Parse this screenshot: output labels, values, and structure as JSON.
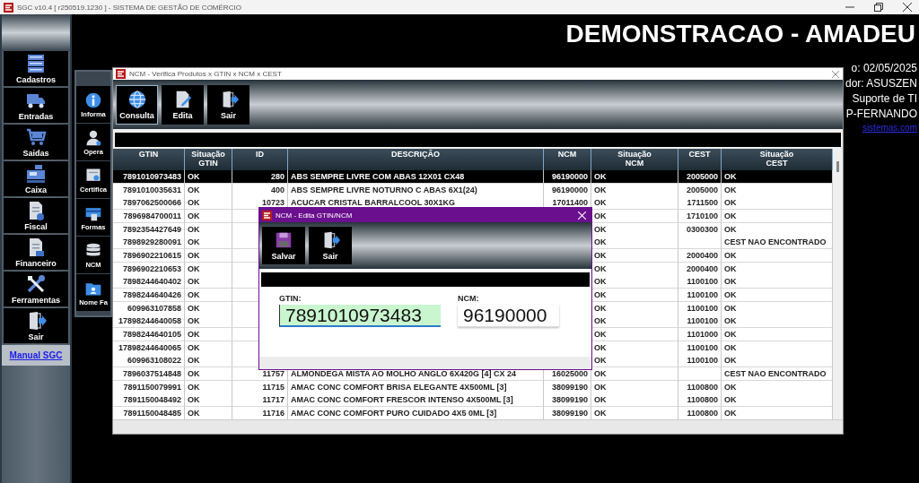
{
  "window": {
    "title": "SGC v10.4 [ r250519.1230 ] - SISTEMA DE GESTÃO DE COMÉRCIO"
  },
  "header": {
    "company": "DEMONSTRACAO - AMADEU",
    "info_lines": [
      "o: 02/05/2025",
      "dor: ASUSZEN",
      "Suporte de TI",
      "P-FERNANDO"
    ],
    "link": "sistemas.com"
  },
  "sidebar": {
    "items": [
      {
        "label": "Cadastros"
      },
      {
        "label": "Entradas"
      },
      {
        "label": "Saidas"
      },
      {
        "label": "Caixa"
      },
      {
        "label": "Fiscal"
      },
      {
        "label": "Financeiro"
      },
      {
        "label": "Ferramentas"
      },
      {
        "label": "Sair"
      }
    ],
    "link": "Manual SGC"
  },
  "submenu": {
    "items": [
      {
        "label": "Informa"
      },
      {
        "label": "Opera"
      },
      {
        "label": "Certifica"
      },
      {
        "label": "Formas"
      },
      {
        "label": "NCM"
      },
      {
        "label": "Nome Fa"
      }
    ]
  },
  "ncm_window": {
    "title": "NCM - Verifica Produtos x GTIN x NCM x CEST",
    "toolbar": [
      {
        "label": "Consulta",
        "selected": true
      },
      {
        "label": "Edita",
        "selected": false
      },
      {
        "label": "Sair",
        "selected": false
      }
    ],
    "table": {
      "columns": [
        "GTIN",
        "Situação\nGTIN",
        "ID",
        "DESCRIÇÃO",
        "NCM",
        "Situação\nNCM",
        "CEST",
        "Situação\nCEST"
      ],
      "rows": [
        {
          "selected": true,
          "cells": [
            "7891010973483",
            "OK",
            "280",
            "ABS SEMPRE LIVRE COM ABAS 12X01  CX48",
            "96190000",
            "OK",
            "2005000",
            "OK"
          ]
        },
        {
          "selected": false,
          "cells": [
            "7891010035631",
            "OK",
            "400",
            "ABS SEMPRE LIVRE NOTURNO C ABAS 6X1(24)",
            "96190000",
            "OK",
            "2005000",
            "OK"
          ]
        },
        {
          "selected": false,
          "cells": [
            "7897062500066",
            "OK",
            "10723",
            "ACUCAR CRISTAL BARRALCOOL  30X1KG",
            "17011400",
            "OK",
            "1711500",
            "OK"
          ]
        },
        {
          "selected": false,
          "cells": [
            "7896984700011",
            "OK",
            null,
            null,
            null,
            "OK",
            "1710100",
            "OK"
          ]
        },
        {
          "selected": false,
          "cells": [
            "7892354427649",
            "OK",
            null,
            null,
            null,
            "OK",
            "0300300",
            "OK"
          ]
        },
        {
          "selected": false,
          "cells": [
            "7898929280091",
            "OK",
            null,
            null,
            null,
            "OK",
            null,
            "CEST NAO ENCONTRADO"
          ]
        },
        {
          "selected": false,
          "cells": [
            "7896902210615",
            "OK",
            null,
            null,
            null,
            "OK",
            "2000400",
            "OK"
          ]
        },
        {
          "selected": false,
          "cells": [
            "7896902210653",
            "OK",
            null,
            null,
            null,
            "OK",
            "2000400",
            "OK"
          ]
        },
        {
          "selected": false,
          "cells": [
            "7898244640402",
            "OK",
            null,
            null,
            null,
            "OK",
            "1100100",
            "OK"
          ]
        },
        {
          "selected": false,
          "cells": [
            "7898244640426",
            "OK",
            null,
            null,
            null,
            "OK",
            "1100100",
            "OK"
          ]
        },
        {
          "selected": false,
          "cells": [
            "609963107858",
            "OK",
            null,
            null,
            null,
            "OK",
            "1100100",
            "OK"
          ]
        },
        {
          "selected": false,
          "cells": [
            "17898244640058",
            "OK",
            null,
            null,
            null,
            "OK",
            "1100100",
            "OK"
          ]
        },
        {
          "selected": false,
          "cells": [
            "7898244640105",
            "OK",
            null,
            null,
            null,
            "OK",
            "1101000",
            "OK"
          ]
        },
        {
          "selected": false,
          "cells": [
            "17898244640065",
            "OK",
            null,
            null,
            null,
            "OK",
            "1100100",
            "OK"
          ]
        },
        {
          "selected": false,
          "cells": [
            "609963108022",
            "OK",
            null,
            null,
            null,
            "OK",
            "1100100",
            "OK"
          ]
        },
        {
          "selected": false,
          "cells": [
            "7896037514848",
            "OK",
            "11757",
            "ALMONDEGA MISTA AO MOLHO ANGLO 6X420G [4] CX 24",
            "16025000",
            "OK",
            null,
            "CEST NAO ENCONTRADO"
          ]
        },
        {
          "selected": false,
          "cells": [
            "7891150079991",
            "OK",
            "11715",
            "AMAC CONC COMFORT BRISA ELEGANTE 4X500ML [3]",
            "38099190",
            "OK",
            "1100800",
            "OK"
          ]
        },
        {
          "selected": false,
          "cells": [
            "7891150048492",
            "OK",
            "11717",
            "AMAC CONC COMFORT FRESCOR INTENSO  4X500ML [3]",
            "38099190",
            "OK",
            "1100800",
            "OK"
          ]
        },
        {
          "selected": false,
          "cells": [
            "7891150048485",
            "OK",
            "11716",
            "AMAC CONC COMFORT PURO CUIDADO  4X5 0ML [3]",
            "38099190",
            "OK",
            "1100800",
            "OK"
          ]
        }
      ]
    }
  },
  "edit_dialog": {
    "title": "NCM - Edita GTIN/NCM",
    "toolbar": [
      {
        "label": "Salvar",
        "selected": false
      },
      {
        "label": "Sair",
        "selected": false
      }
    ],
    "fields": [
      {
        "label": "GTIN:",
        "value": "7891010973483",
        "focused": true
      },
      {
        "label": "NCM:",
        "value": "96190000",
        "focused": false
      }
    ]
  }
}
